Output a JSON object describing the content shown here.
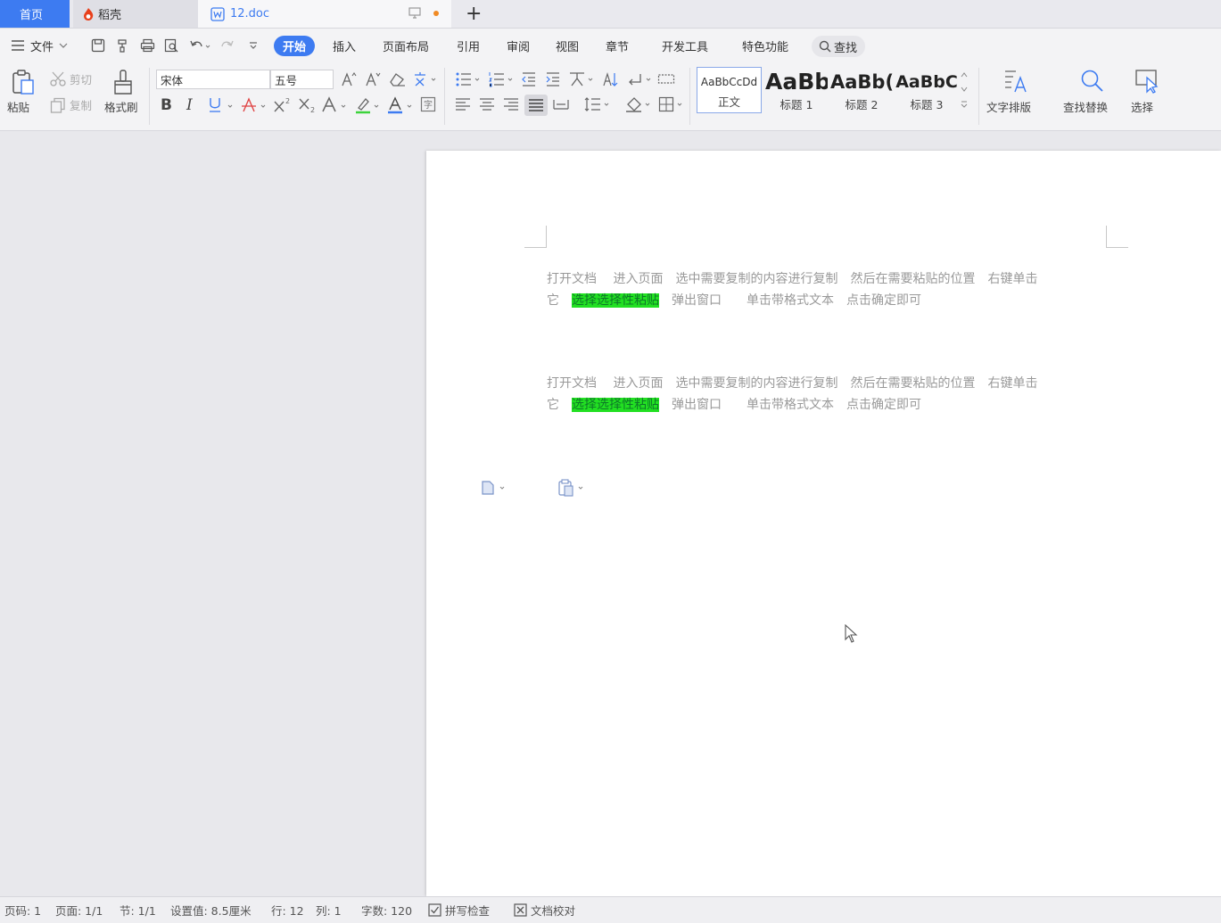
{
  "tabs": {
    "home": "首页",
    "daoke": "稻壳",
    "doc": "12.doc",
    "add": "+"
  },
  "menu": {
    "file": "文件",
    "items": [
      "开始",
      "插入",
      "页面布局",
      "引用",
      "审阅",
      "视图",
      "章节",
      "开发工具",
      "特色功能"
    ],
    "search": "查找"
  },
  "ribbon": {
    "paste": "粘贴",
    "cut": "剪切",
    "copy": "复制",
    "format_painter": "格式刷",
    "font": "宋体",
    "size": "五号",
    "styles": [
      {
        "preview": "AaBbCcDd",
        "caption": "正文"
      },
      {
        "preview": "AaBb",
        "caption": "标题 1"
      },
      {
        "preview": "AaBb(",
        "caption": "标题 2"
      },
      {
        "preview": "AaBbC",
        "caption": "标题 3"
      }
    ],
    "text_layout": "文字排版",
    "find_replace": "查找替换",
    "select": "选择"
  },
  "document": {
    "paragraphs": [
      {
        "line1": "打开文档　 进入页面　选中需要复制的内容进行复制　然后在需要粘贴的位置　右键单击",
        "line2_pre": "它　",
        "highlight": "选择选择性粘贴",
        "line2_post": "　弹出窗口　　单击带格式文本　点击确定即可"
      },
      {
        "line1": "打开文档　 进入页面　选中需要复制的内容进行复制　然后在需要粘贴的位置　右键单击",
        "line2_pre": "它　",
        "highlight": "选择选择性粘贴",
        "line2_post": "　弹出窗口　　单击带格式文本　点击确定即可"
      }
    ]
  },
  "status": {
    "page_no": "页码: 1",
    "pages": "页面: 1/1",
    "section": "节: 1/1",
    "setting": "设置值: 8.5厘米",
    "row": "行: 12",
    "col": "列: 1",
    "words": "字数: 120",
    "spell": "拼写检查",
    "proof": "文档校对"
  },
  "colors": {
    "accent": "#3d7bf1",
    "highlight": "#22e022"
  }
}
